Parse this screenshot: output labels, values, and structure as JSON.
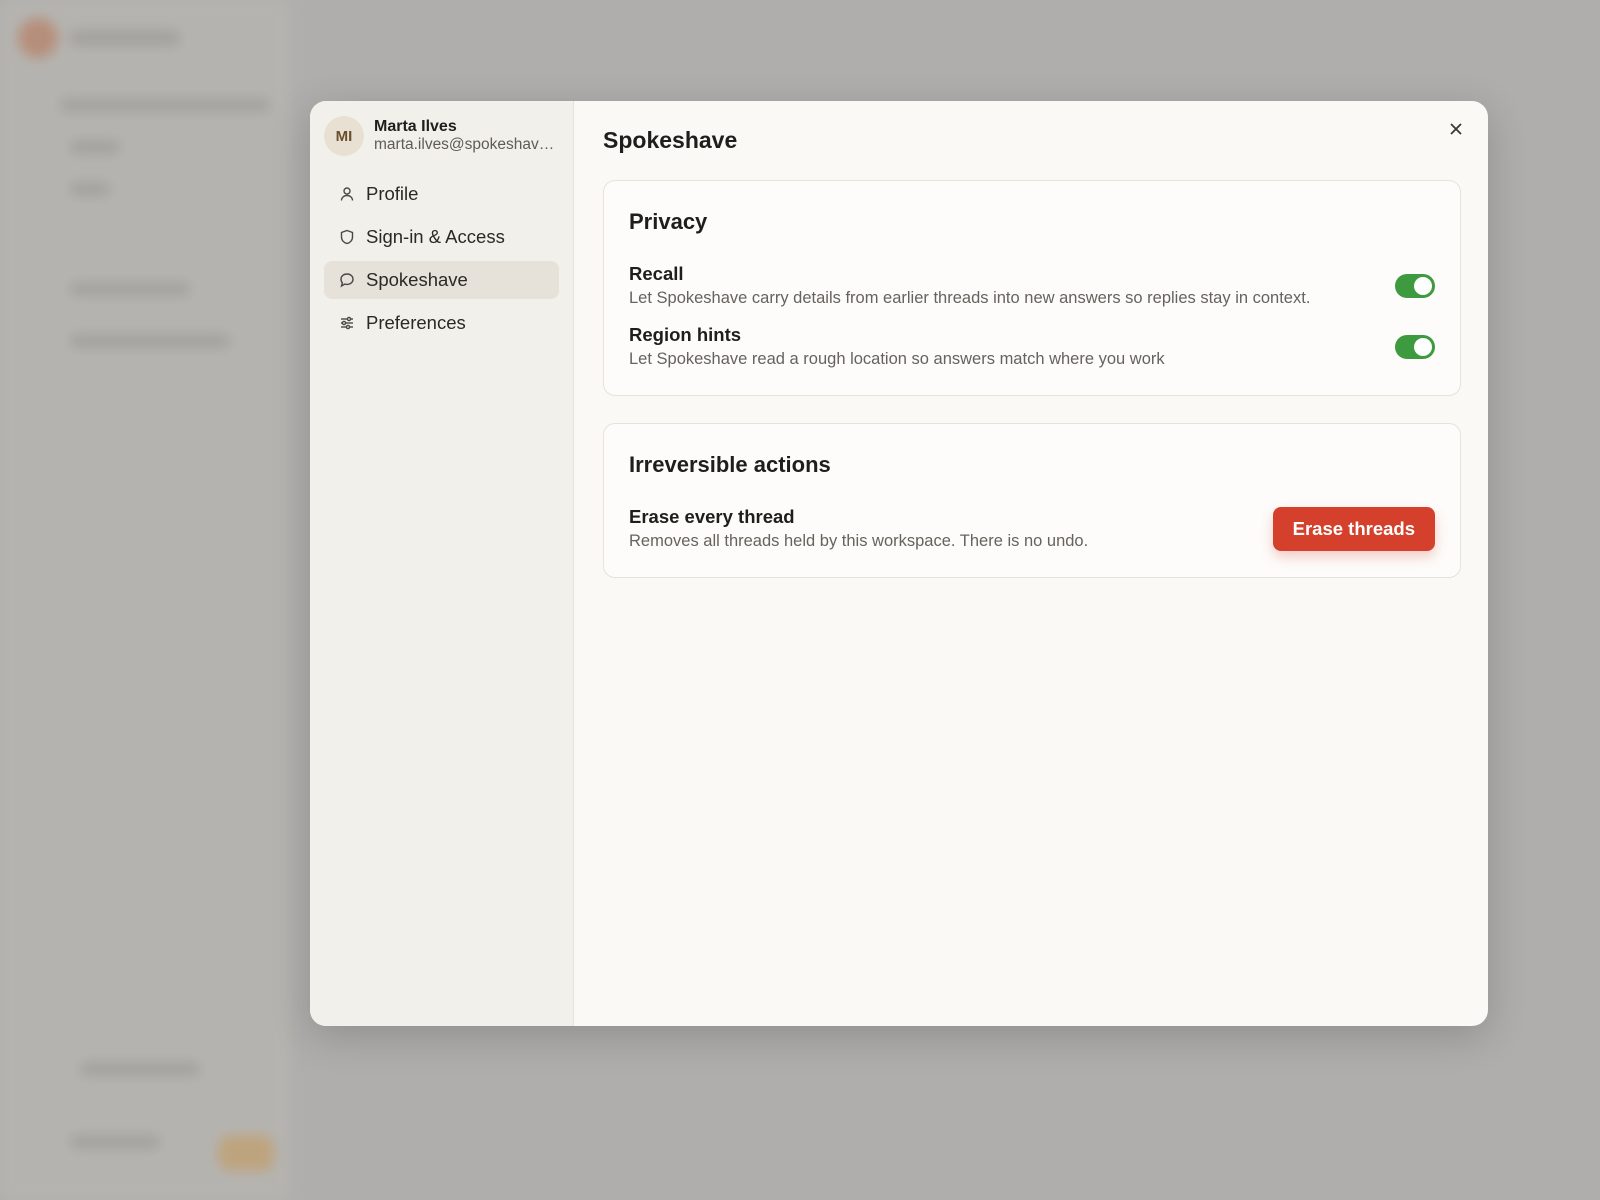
{
  "account": {
    "initials": "MI",
    "name": "Marta Ilves",
    "email": "marta.ilves@spokeshave.com"
  },
  "nav": {
    "items": [
      {
        "label": "Profile",
        "icon": "person-icon",
        "active": false
      },
      {
        "label": "Sign-in & Access",
        "icon": "shield-icon",
        "active": false
      },
      {
        "label": "Spokeshave",
        "icon": "chat-bubble-icon",
        "active": true
      },
      {
        "label": "Preferences",
        "icon": "sliders-icon",
        "active": false
      }
    ]
  },
  "main": {
    "title": "Spokeshave",
    "privacy": {
      "heading": "Privacy",
      "settings": [
        {
          "title": "Recall",
          "description": "Let Spokeshave carry details from earlier threads into new answers so replies stay in context.",
          "enabled": true
        },
        {
          "title": "Region hints",
          "description": "Let Spokeshave read a rough location so answers match where you work",
          "enabled": true
        }
      ]
    },
    "danger": {
      "heading": "Irreversible actions",
      "title": "Erase every thread",
      "description": "Removes all threads held by this workspace. There is no undo.",
      "button_label": "Erase threads"
    }
  },
  "colors": {
    "toggle_on": "#3e9a3e",
    "danger": "#d4402b",
    "nav_active": "#e6e2d9"
  }
}
